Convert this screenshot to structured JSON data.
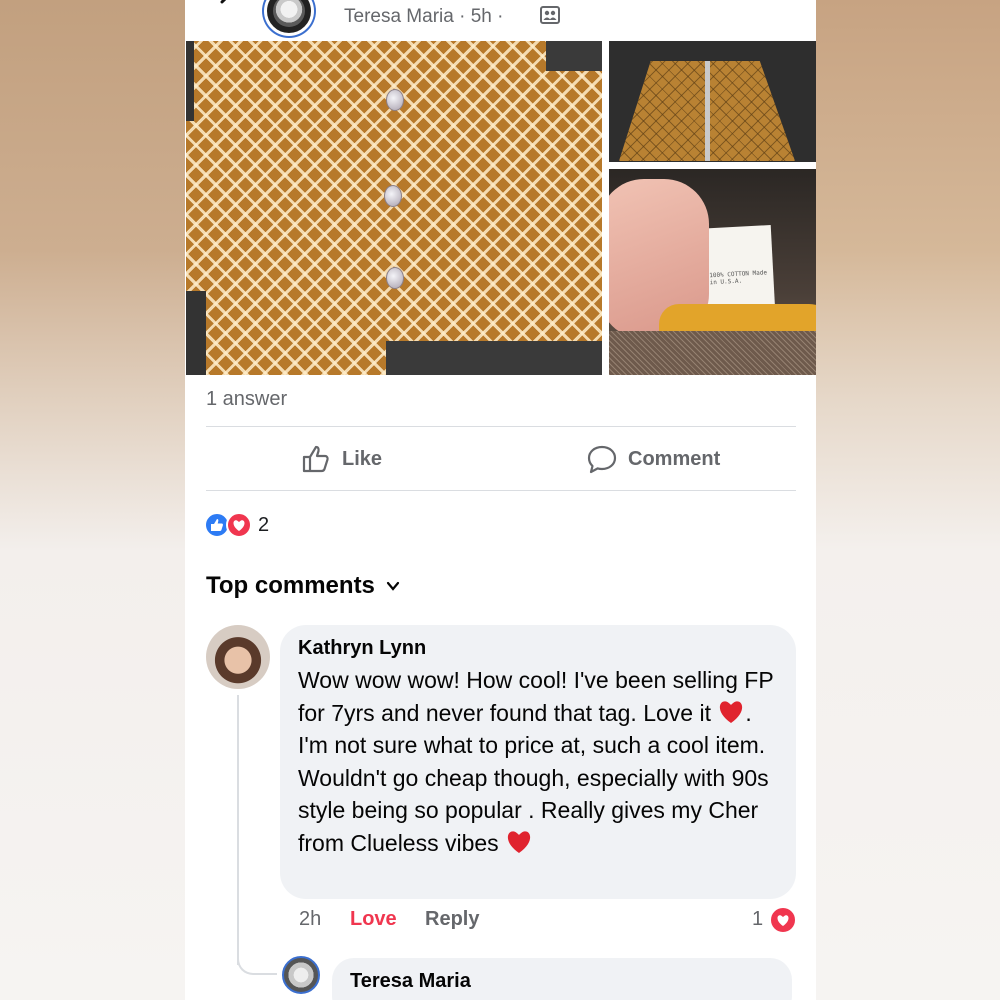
{
  "post": {
    "author": "Teresa Maria",
    "meta": " · 5h · ",
    "answers": "1 answer",
    "tag_text": "100% COTTON Made in U.S.A."
  },
  "actions": {
    "like": "Like",
    "comment": "Comment"
  },
  "reactions": {
    "count": "2"
  },
  "comments_header": "Top comments",
  "comment": {
    "author": "Kathryn Lynn",
    "line1": "Wow wow wow! How cool! I've been selling FP for 7yrs and never found that tag. Love it",
    "line1_tail": ".",
    "line2": "I'm not sure what to price at, such a cool item. Wouldn't go cheap though, especially with 90s style being so popular . Really gives my Cher from Clueless vibes",
    "time": "2h",
    "love_label": "Love",
    "reply_label": "Reply",
    "reaction_count": "1"
  },
  "reply": {
    "author": "Teresa Maria"
  },
  "colors": {
    "accent": "#2d7bf4",
    "love": "#f0364f",
    "muted": "#65676b"
  }
}
